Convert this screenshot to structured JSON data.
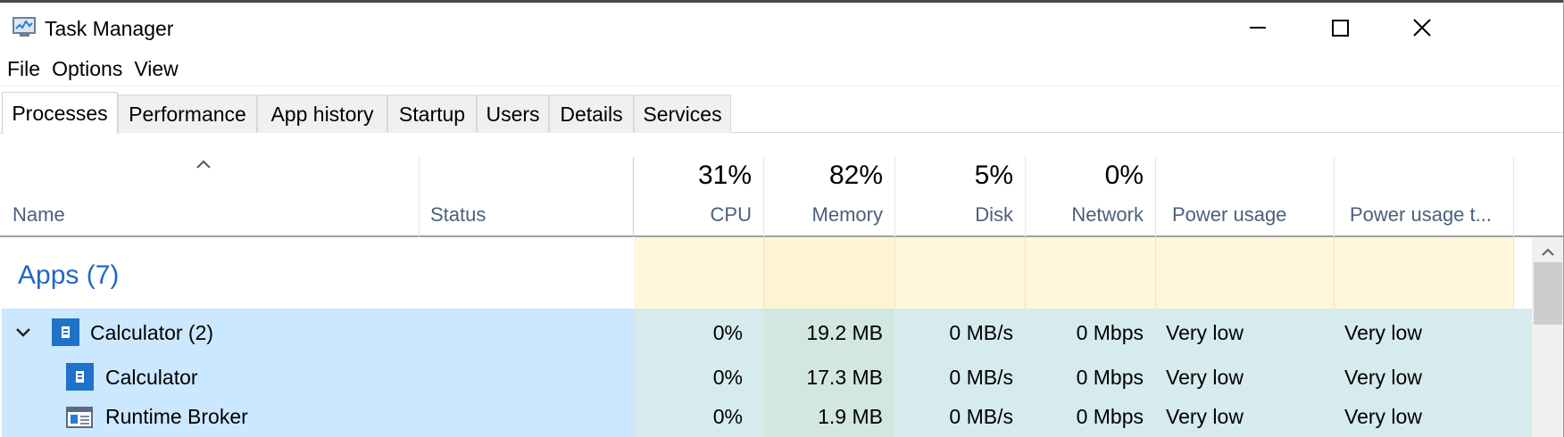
{
  "window": {
    "title": "Task Manager",
    "icon": "task-manager-app-icon",
    "controls": [
      "minimize-icon",
      "maximize-icon",
      "close-icon"
    ]
  },
  "menu": [
    "File",
    "Options",
    "View"
  ],
  "tabs": [
    {
      "label": "Processes",
      "active": true
    },
    {
      "label": "Performance",
      "active": false
    },
    {
      "label": "App history",
      "active": false
    },
    {
      "label": "Startup",
      "active": false
    },
    {
      "label": "Users",
      "active": false
    },
    {
      "label": "Details",
      "active": false
    },
    {
      "label": "Services",
      "active": false
    }
  ],
  "columns": {
    "name": {
      "label": "Name",
      "sort_icon": "chevron-up-icon"
    },
    "status": {
      "label": "Status"
    },
    "cpu": {
      "label": "CPU",
      "percent": "31%"
    },
    "memory": {
      "label": "Memory",
      "percent": "82%"
    },
    "disk": {
      "label": "Disk",
      "percent": "5%"
    },
    "network": {
      "label": "Network",
      "percent": "0%"
    },
    "power": {
      "label": "Power usage"
    },
    "power_trend": {
      "label": "Power usage t..."
    }
  },
  "groups": [
    {
      "label": "Apps (7)",
      "rows": [
        {
          "name": "Calculator (2)",
          "expandable": true,
          "icon": "calculator-icon",
          "cpu": "0%",
          "memory": "19.2 MB",
          "disk": "0 MB/s",
          "network": "0 Mbps",
          "power": "Very low",
          "power_trend": "Very low"
        },
        {
          "name": "Calculator",
          "expandable": false,
          "icon": "calculator-icon",
          "cpu": "0%",
          "memory": "17.3 MB",
          "disk": "0 MB/s",
          "network": "0 Mbps",
          "power": "Very low",
          "power_trend": "Very low"
        },
        {
          "name": "Runtime Broker",
          "expandable": false,
          "icon": "runtime-broker-icon",
          "cpu": "0%",
          "memory": "1.9 MB",
          "disk": "0 MB/s",
          "network": "0 Mbps",
          "power": "Very low",
          "power_trend": "Very low"
        }
      ]
    }
  ],
  "colors": {
    "group_heading": "#2166c8",
    "column_label": "#4c607a",
    "selection": "#cce8ff",
    "heat_low": "#fff6dc"
  }
}
